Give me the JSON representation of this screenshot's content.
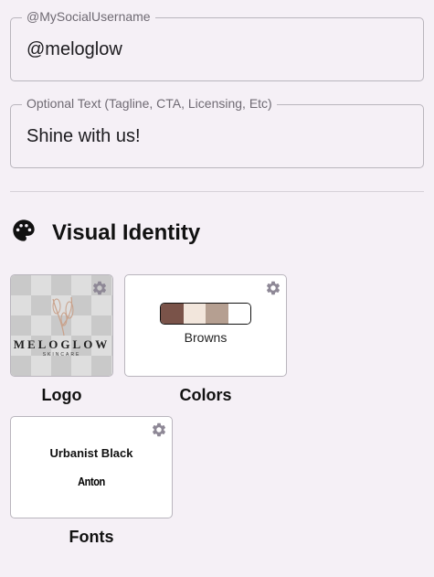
{
  "social": {
    "legend": "@MySocialUsername",
    "value": "@meloglow"
  },
  "optional": {
    "legend": "Optional Text (Tagline, CTA, Licensing, Etc)",
    "value": "Shine with us!"
  },
  "visual_identity": {
    "title": "Visual Identity",
    "icon": "palette-icon"
  },
  "logo": {
    "caption": "Logo",
    "brand": "MELOGLOW",
    "sub": "SKINCARE",
    "icon": "gear-icon"
  },
  "colors": {
    "caption": "Colors",
    "palette_name": "Browns",
    "swatches": [
      "#7a5349",
      "#f2e6dc",
      "#b59f91",
      "#ffffff"
    ],
    "icon": "gear-icon"
  },
  "fonts": {
    "caption": "Fonts",
    "primary": "Urbanist Black",
    "secondary": "Anton",
    "icon": "gear-icon"
  }
}
